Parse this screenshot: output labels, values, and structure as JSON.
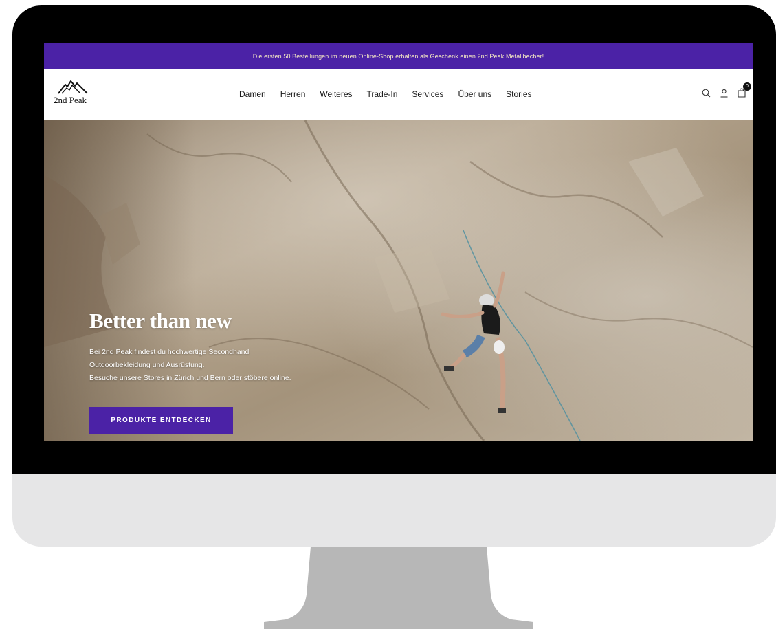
{
  "announcement": {
    "text": "Die ersten 50 Bestellungen im neuen Online-Shop erhalten als Geschenk einen 2nd Peak Metallbecher!"
  },
  "header": {
    "logo_text": "2nd Peak",
    "nav": [
      {
        "label": "Damen"
      },
      {
        "label": "Herren"
      },
      {
        "label": "Weiteres"
      },
      {
        "label": "Trade-In"
      },
      {
        "label": "Services"
      },
      {
        "label": "Über uns"
      },
      {
        "label": "Stories"
      }
    ],
    "icons": [
      "search-icon",
      "account-icon",
      "cart-icon"
    ],
    "cart_count": "0"
  },
  "hero": {
    "title": "Better than new",
    "lines": [
      "Bei 2nd Peak findest du hochwertige Secondhand",
      "Outdoorbekleidung und Ausrüstung.",
      "Besuche unsere Stores in Zürich und Bern oder stöbere online."
    ],
    "cta_label": "PRODUKTE ENTDECKEN"
  },
  "colors": {
    "brand_purple": "#4b22a6",
    "announcement_text": "#f6e9c4",
    "bezel": "#000000",
    "chin": "#e6e6e7",
    "stand": "#b7b7b7"
  }
}
